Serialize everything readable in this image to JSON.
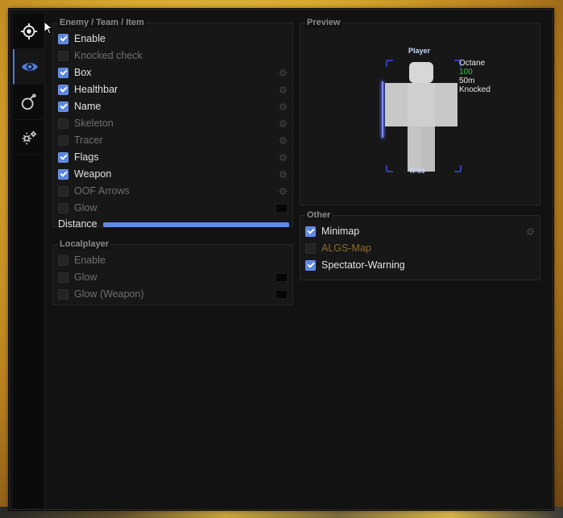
{
  "sidebar": {
    "tabs": [
      {
        "icon": "crosshair-icon",
        "active": false
      },
      {
        "icon": "eye-icon",
        "active": true
      },
      {
        "icon": "grenade-icon",
        "active": false
      },
      {
        "icon": "settings-icon",
        "active": false
      }
    ]
  },
  "enemy_panel": {
    "title": "Enemy / Team / Item",
    "items": [
      {
        "label": "Enable",
        "checked": true
      },
      {
        "label": "Knocked check",
        "checked": false
      },
      {
        "label": "Box",
        "checked": true
      },
      {
        "label": "Healthbar",
        "checked": true
      },
      {
        "label": "Name",
        "checked": true
      },
      {
        "label": "Skeleton",
        "checked": false
      },
      {
        "label": "Tracer",
        "checked": false
      },
      {
        "label": "Flags",
        "checked": true
      },
      {
        "label": "Weapon",
        "checked": true
      },
      {
        "label": "OOF Arrows",
        "checked": false
      },
      {
        "label": "Glow",
        "checked": false
      }
    ],
    "distance_label": "Distance",
    "distance_value": 1.0
  },
  "localplayer_panel": {
    "title": "Localplayer",
    "items": [
      {
        "label": "Enable",
        "checked": false
      },
      {
        "label": "Glow",
        "checked": false
      },
      {
        "label": "Glow (Weapon)",
        "checked": false
      }
    ]
  },
  "preview_panel": {
    "title": "Preview",
    "player_name": "Player",
    "flags": {
      "name": "Octane",
      "health": "100",
      "distance": "50m",
      "status": "Knocked"
    },
    "weapon": "R-99"
  },
  "other_panel": {
    "title": "Other",
    "items": [
      {
        "label": "Minimap",
        "checked": true
      },
      {
        "label": "ALGS-Map",
        "checked": false
      },
      {
        "label": "Spectator-Warning",
        "checked": true
      }
    ]
  },
  "colors": {
    "accent": "#5a86e0",
    "health_text": "#35c34a",
    "algs_label": "#8a6d32"
  }
}
